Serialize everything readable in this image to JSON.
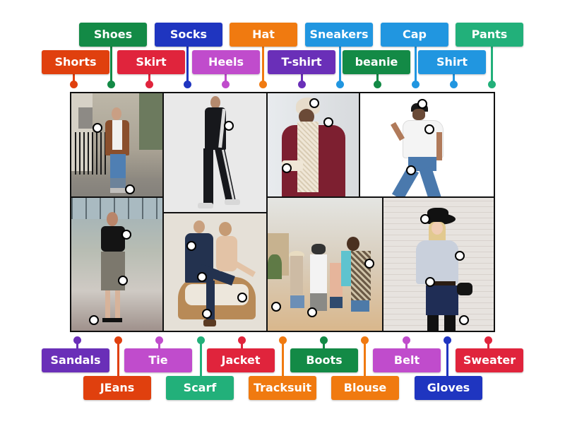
{
  "top_labels": [
    {
      "text": "Shoes",
      "color": "#138a46"
    },
    {
      "text": "Socks",
      "color": "#1f35c0"
    },
    {
      "text": "Hat",
      "color": "#f07a10"
    },
    {
      "text": "Sneakers",
      "color": "#2196e0"
    },
    {
      "text": "Cap",
      "color": "#2196e0"
    },
    {
      "text": "Pants",
      "color": "#22b07a"
    },
    {
      "text": "Shorts",
      "color": "#e0400e"
    },
    {
      "text": "Skirt",
      "color": "#e0243c"
    },
    {
      "text": "Heels",
      "color": "#c04ccc"
    },
    {
      "text": "T-shirt",
      "color": "#6a2fb8"
    },
    {
      "text": "beanie",
      "color": "#138a46"
    },
    {
      "text": "Shirt",
      "color": "#2196e0"
    }
  ],
  "bottom_labels": [
    {
      "text": "Sandals",
      "color": "#6a2fb8"
    },
    {
      "text": "Tie",
      "color": "#c04ccc"
    },
    {
      "text": "Jacket",
      "color": "#e0243c"
    },
    {
      "text": "Boots",
      "color": "#138a46"
    },
    {
      "text": "Belt",
      "color": "#c04ccc"
    },
    {
      "text": "Sweater",
      "color": "#e0243c"
    },
    {
      "text": "JEans",
      "color": "#e0400e"
    },
    {
      "text": "Scarf",
      "color": "#22b07a"
    },
    {
      "text": "Tracksuit",
      "color": "#f07a10"
    },
    {
      "text": "Blouse",
      "color": "#f07a10"
    },
    {
      "text": "Gloves",
      "color": "#1f35c0"
    }
  ],
  "photos": [
    {
      "name": "man-leather-jacket-jeans"
    },
    {
      "name": "man-tracksuit"
    },
    {
      "name": "woman-beanie-scarf-gloves"
    },
    {
      "name": "man-cap-tshirt-jeans"
    },
    {
      "name": "woman-blouse-skirt-heels"
    },
    {
      "name": "couple-suit-tie-shoes"
    },
    {
      "name": "friends-beach-shorts-sandals"
    },
    {
      "name": "woman-hat-sweater-belt-boots"
    }
  ]
}
